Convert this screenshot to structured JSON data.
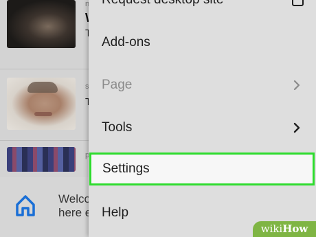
{
  "feed": {
    "items": [
      {
        "title_fragment": "W",
        "sub_fragment": "T",
        "meta_fragment": "n"
      },
      {
        "title_fragment": "T",
        "sub_fragment": "",
        "meta_fragment": "s"
      },
      {
        "title_fragment": "",
        "sub_fragment": "",
        "meta_fragment": "p"
      }
    ],
    "welcome_line1": "Welco",
    "welcome_line2": "here e",
    "home_icon": "home-icon"
  },
  "menu": {
    "items": [
      {
        "label": "Request desktop site",
        "icon": "checkbox-icon",
        "state": "enabled"
      },
      {
        "label": "Add-ons",
        "icon": "",
        "state": "enabled"
      },
      {
        "label": "Page",
        "icon": "chevron-right-icon",
        "state": "disabled"
      },
      {
        "label": "Tools",
        "icon": "chevron-right-icon",
        "state": "enabled"
      },
      {
        "label": "Settings",
        "icon": "",
        "state": "highlighted"
      },
      {
        "label": "Help",
        "icon": "",
        "state": "enabled"
      }
    ],
    "highlight_color": "#2ddc2d"
  },
  "watermark": {
    "part1": "wiki",
    "part2": "How"
  },
  "colors": {
    "accent_blue": "#1a6fd6",
    "watermark_green": "#7fb544"
  }
}
